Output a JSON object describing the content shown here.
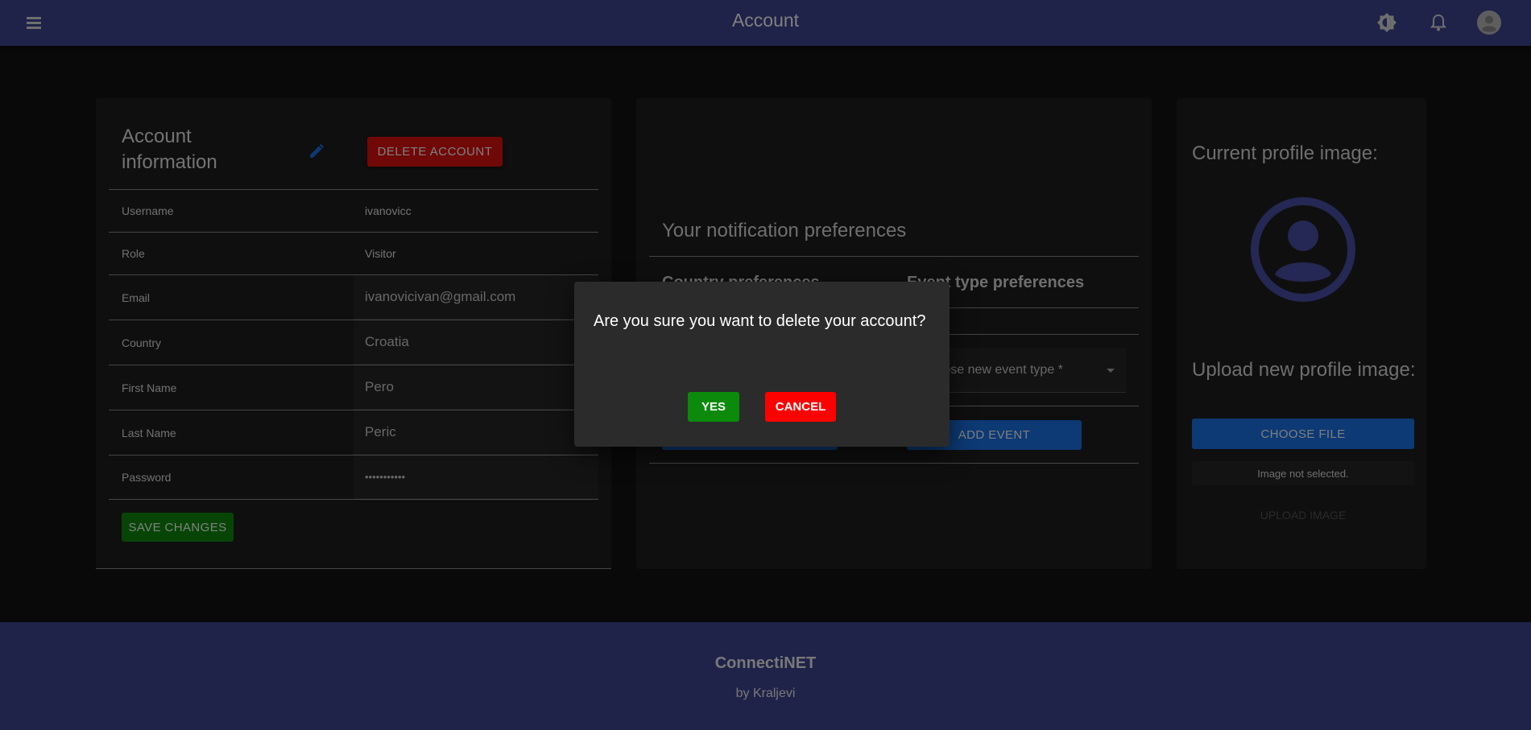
{
  "header": {
    "title": "Account",
    "menu_icon": "hamburger-icon",
    "theme_icon": "brightness-icon",
    "notifications_icon": "bell-icon",
    "profile_icon": "account-circle-icon"
  },
  "account": {
    "title": "Account information",
    "edit_icon": "pencil-icon",
    "delete_label": "DELETE ACCOUNT",
    "fields": [
      {
        "label": "Username",
        "value": "ivanovicc"
      },
      {
        "label": "Role",
        "value": "Visitor"
      },
      {
        "label": "Email",
        "value": "ivanovicivan@gmail.com"
      },
      {
        "label": "Country",
        "value": "Croatia"
      },
      {
        "label": "First Name",
        "value": "Pero"
      },
      {
        "label": "Last Name",
        "value": "Peric"
      },
      {
        "label": "Password",
        "value": "•••••••••••"
      }
    ],
    "save_label": "SAVE CHANGES"
  },
  "notifications": {
    "title": "Your notification preferences",
    "country_heading": "Country preferences",
    "event_heading": "Event type preferences",
    "event_select_placeholder": "Choose new event type *",
    "add_event_label": "ADD EVENT"
  },
  "profile_image": {
    "current_label": "Current profile image:",
    "upload_label": "Upload new profile image:",
    "choose_file_label": "CHOOSE FILE",
    "status_text": "Image not selected.",
    "upload_button_label": "UPLOAD IMAGE"
  },
  "footer": {
    "brand": "ConnectiNET",
    "by": "by Kraljevi"
  },
  "dialog": {
    "message": "Are you sure you want to delete your account?",
    "yes_label": "YES",
    "cancel_label": "CANCEL"
  },
  "colors": {
    "header_bg": "#3f4493",
    "delete": "#e01010",
    "save": "#0f8a0f",
    "primary": "#1a73e8",
    "cancel": "#ff0000"
  }
}
